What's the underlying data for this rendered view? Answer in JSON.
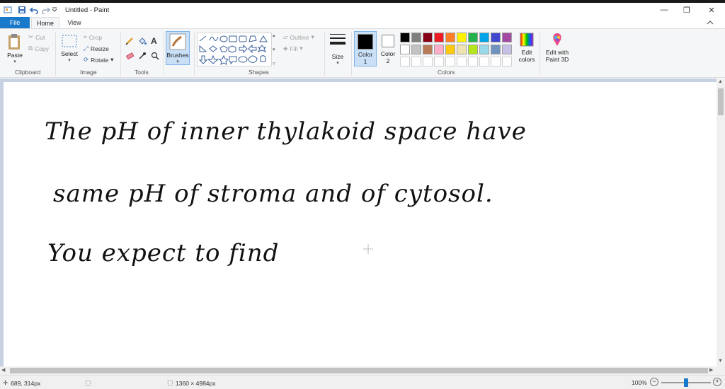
{
  "window": {
    "title": "Untitled - Paint",
    "minimize": "—",
    "restore": "❐",
    "close": "✕"
  },
  "tabs": {
    "file": "File",
    "home": "Home",
    "view": "View"
  },
  "ribbon": {
    "clipboard": {
      "label": "Clipboard",
      "paste": "Paste",
      "cut": "Cut",
      "copy": "Copy"
    },
    "image": {
      "label": "Image",
      "select": "Select",
      "crop": "Crop",
      "resize": "Resize",
      "rotate": "Rotate"
    },
    "tools": {
      "label": "Tools"
    },
    "brushes": {
      "label": "Brushes"
    },
    "shapes": {
      "label": "Shapes",
      "outline": "Outline",
      "fill": "Fill"
    },
    "size": {
      "label": "Size"
    },
    "colors": {
      "label": "Colors",
      "color1": "Color 1",
      "color2": "Color 2",
      "color1_line1": "Color",
      "color1_line2": "1",
      "color2_line1": "Color",
      "color2_line2": "2",
      "edit_colors_line1": "Edit",
      "edit_colors_line2": "colors",
      "color1_value": "#000000",
      "color2_value": "#ffffff",
      "palette_row1": [
        "#000000",
        "#7f7f7f",
        "#880015",
        "#ed1c24",
        "#ff7f27",
        "#fff200",
        "#22b14c",
        "#00a2e8",
        "#3f48cc",
        "#a349a4"
      ],
      "palette_row2": [
        "#ffffff",
        "#c3c3c3",
        "#b97a57",
        "#ffaec9",
        "#ffc90e",
        "#efe4b0",
        "#b5e61d",
        "#99d9ea",
        "#7092be",
        "#c8bfe7"
      ]
    },
    "paint3d": {
      "line1": "Edit with",
      "line2": "Paint 3D"
    }
  },
  "canvas": {
    "line1": "The  pH  of  inner  thylakoid  space  have",
    "line2": "same  pH  of  stroma  and  of  cytosol.",
    "line3": "You  expect  to  find"
  },
  "status": {
    "cursor": "689, 314px",
    "dimensions": "1360 × 4984px",
    "zoom": "100%"
  }
}
